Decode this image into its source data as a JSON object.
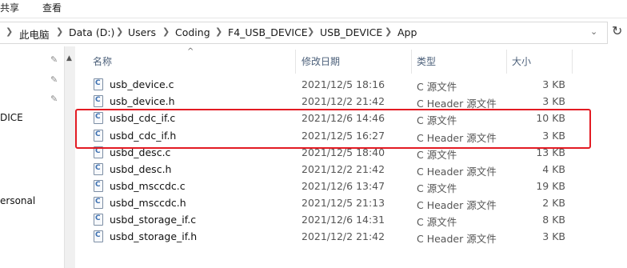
{
  "ribbon": {
    "tab_share": "共享",
    "tab_view": "查看"
  },
  "breadcrumb": [
    "此电脑",
    "Data (D:)",
    "Users",
    "Coding",
    "F4_USB_DEVICE",
    "USB_DEVICE",
    "App"
  ],
  "nav": {
    "item_device": "DICE",
    "item_personal": "ersonal"
  },
  "columns": {
    "name": "名称",
    "date": "修改日期",
    "type": "类型",
    "size": "大小"
  },
  "files": [
    {
      "name": "usb_device.c",
      "date": "2021/12/5 18:16",
      "type": "C 源文件",
      "size": "3 KB"
    },
    {
      "name": "usb_device.h",
      "date": "2021/12/2 21:42",
      "type": "C Header 源文件",
      "size": "3 KB"
    },
    {
      "name": "usbd_cdc_if.c",
      "date": "2021/12/6 14:46",
      "type": "C 源文件",
      "size": "10 KB"
    },
    {
      "name": "usbd_cdc_if.h",
      "date": "2021/12/5 16:27",
      "type": "C Header 源文件",
      "size": "3 KB"
    },
    {
      "name": "usbd_desc.c",
      "date": "2021/12/5 18:40",
      "type": "C 源文件",
      "size": "13 KB"
    },
    {
      "name": "usbd_desc.h",
      "date": "2021/12/2 21:42",
      "type": "C Header 源文件",
      "size": "4 KB"
    },
    {
      "name": "usbd_msccdc.c",
      "date": "2021/12/6 13:47",
      "type": "C 源文件",
      "size": "19 KB"
    },
    {
      "name": "usbd_msccdc.h",
      "date": "2021/12/5 21:13",
      "type": "C Header 源文件",
      "size": "2 KB"
    },
    {
      "name": "usbd_storage_if.c",
      "date": "2021/12/6 14:31",
      "type": "C 源文件",
      "size": "8 KB"
    },
    {
      "name": "usbd_storage_if.h",
      "date": "2021/12/2 21:42",
      "type": "C Header 源文件",
      "size": "3 KB"
    }
  ],
  "highlight_color": "#e31b23"
}
